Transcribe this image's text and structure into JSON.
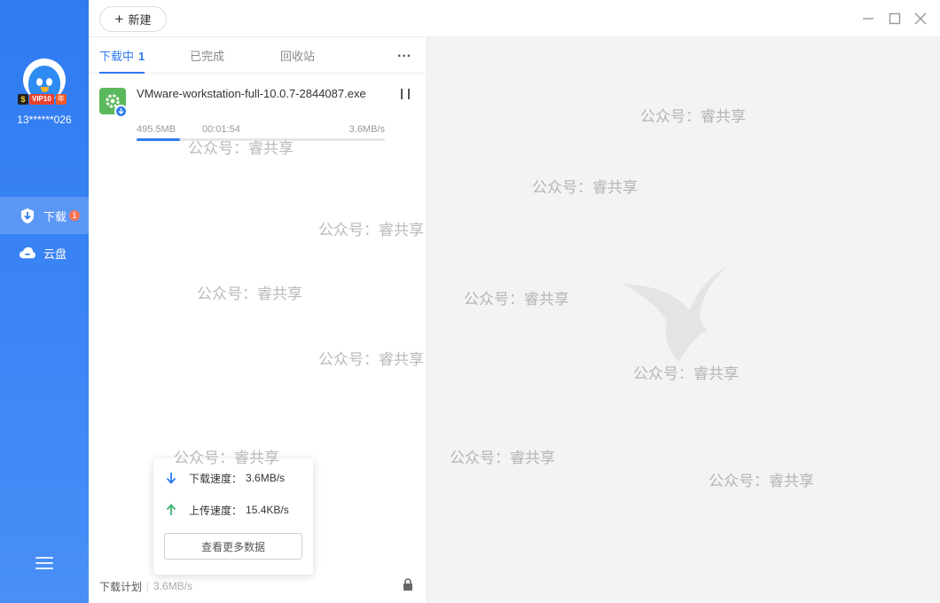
{
  "sidebar": {
    "account": "13******026",
    "vip": {
      "s": "$",
      "label": "VIP10",
      "year": "年"
    },
    "nav": [
      {
        "label": "下载",
        "badge": "1",
        "icon": "download-shield-icon"
      },
      {
        "label": "云盘",
        "icon": "cloud-icon"
      }
    ],
    "menu_icon": "hamburger-menu-icon"
  },
  "topbar": {
    "new_label": "新建",
    "window_controls": [
      "minimize-icon",
      "maximize-icon",
      "close-icon"
    ]
  },
  "tabs": [
    {
      "label": "下载中",
      "count": "1",
      "active": true
    },
    {
      "label": "已完成"
    },
    {
      "label": "回收站"
    }
  ],
  "more_label": "···",
  "task": {
    "name": "VMware-workstation-full-10.0.7-2844087.exe",
    "size": "495.5MB",
    "remaining": "00:01:54",
    "speed": "3.6MB/s",
    "progress": 0.175
  },
  "speed_popup": {
    "down_label": "下载速度：",
    "down_value": "3.6MB/s",
    "up_label": "上传速度：",
    "up_value": "15.4KB/s",
    "more_button": "查看更多数据"
  },
  "footer": {
    "plan_label": "下载计划",
    "speed": "3.6MB/s"
  },
  "watermark": "公众号：睿共享",
  "colors": {
    "accent": "#2f7bf0",
    "download_arrow": "#2f7bf0",
    "upload_arrow": "#3cb371",
    "badge": "#f5735a",
    "empty_bg": "#f3f3f3"
  }
}
